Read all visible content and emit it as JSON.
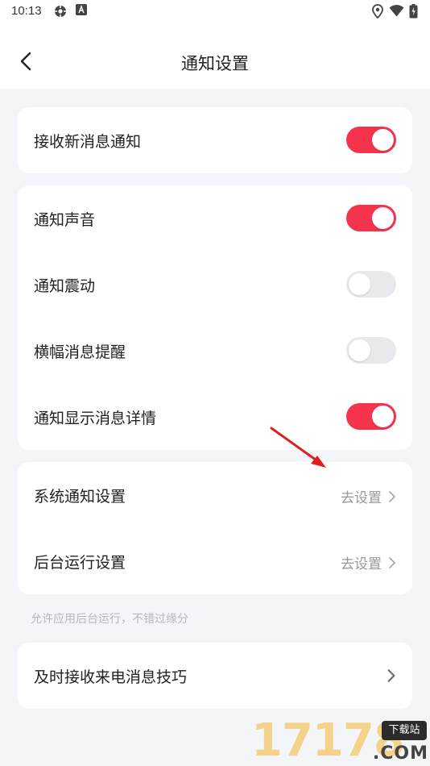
{
  "status_bar": {
    "time": "10:13",
    "icons": [
      "gear-notification-icon",
      "a-notification-icon",
      "location-icon",
      "wifi-icon",
      "battery-icon"
    ]
  },
  "header": {
    "title": "通知设置",
    "back_icon": "chevron-left-icon"
  },
  "colors": {
    "toggle_on": "#f4344d",
    "toggle_off": "#e8e9ec",
    "page_background": "#f4f5f9",
    "card_background": "#ffffff",
    "secondary_text": "#999999"
  },
  "card1": {
    "receive_new_message": {
      "label": "接收新消息通知",
      "enabled": true
    }
  },
  "card2": {
    "sound": {
      "label": "通知声音",
      "enabled": true
    },
    "vibrate": {
      "label": "通知震动",
      "enabled": false
    },
    "banner": {
      "label": "横幅消息提醒",
      "enabled": false
    },
    "show_details": {
      "label": "通知显示消息详情",
      "enabled": true
    }
  },
  "card3": {
    "system_notification": {
      "label": "系统通知设置",
      "action": "去设置"
    },
    "background_run": {
      "label": "后台运行设置",
      "action": "去设置"
    }
  },
  "hint": "允许应用后台运行，不错过缘分",
  "card4": {
    "call_tips": {
      "label": "及时接收来电消息技巧"
    }
  },
  "watermark": {
    "number": "17178",
    "tag": "下载站",
    "suffix": ".COM"
  }
}
